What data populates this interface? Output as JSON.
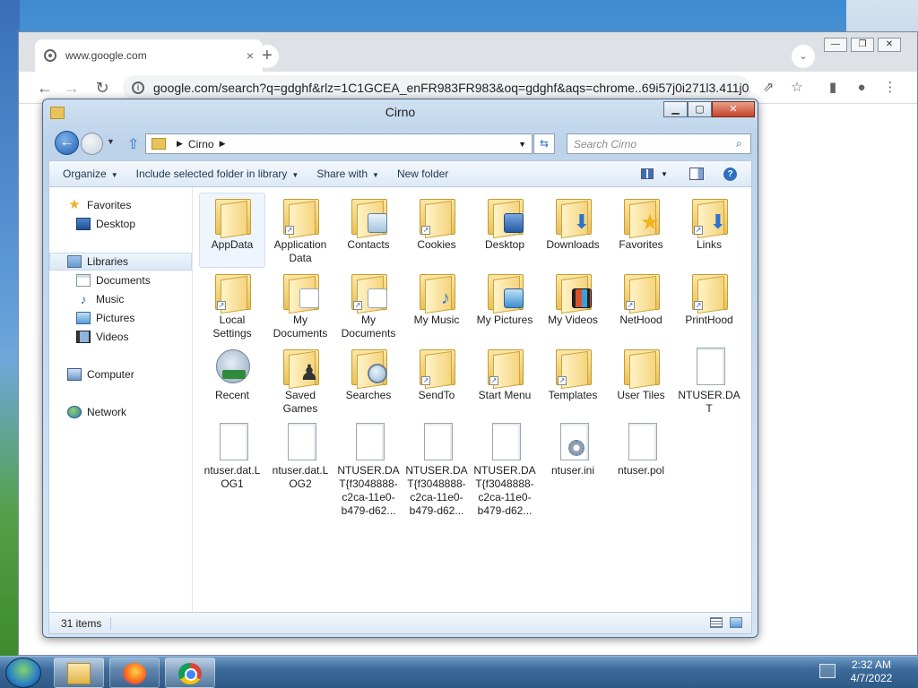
{
  "chrome": {
    "tab_title": "www.google.com",
    "tab_close": "×",
    "new_tab": "+",
    "url": "google.com/search?q=gdghf&rlz=1C1GCEA_enFR983FR983&oq=gdghf&aqs=chrome..69i57j0i271l3.411j0...",
    "nav_back": "←",
    "nav_forward": "→",
    "nav_reload": "↻",
    "win_minimize": "—",
    "win_maximize": "❐",
    "win_close": "✕",
    "tab_search": "⌄",
    "share": "⇗",
    "bookmark": "☆",
    "side_panel": "▮",
    "profile": "●",
    "menu": "⋮",
    "site_info": "i"
  },
  "explorer": {
    "title": "Cirno",
    "caption_min": "▁",
    "caption_max": "▢",
    "caption_close": "✕",
    "back": "←",
    "up": "⇧",
    "breadcrumb": "Cirno",
    "refresh": "⇆",
    "search_placeholder": "Search Cirno",
    "toolbar": {
      "organize": "Organize",
      "include": "Include selected folder in library",
      "share": "Share with",
      "new_folder": "New folder",
      "help": "?"
    },
    "sidebar": {
      "favorites": "Favorites",
      "desktop": "Desktop",
      "libraries": "Libraries",
      "documents": "Documents",
      "music": "Music",
      "pictures": "Pictures",
      "videos": "Videos",
      "computer": "Computer",
      "network": "Network"
    },
    "items": [
      {
        "label": "AppData",
        "type": "folder"
      },
      {
        "label": "Application Data",
        "type": "folder-shortcut"
      },
      {
        "label": "Contacts",
        "type": "folder-contacts"
      },
      {
        "label": "Cookies",
        "type": "folder-shortcut"
      },
      {
        "label": "Desktop",
        "type": "folder-desktop"
      },
      {
        "label": "Downloads",
        "type": "folder-downloads"
      },
      {
        "label": "Favorites",
        "type": "folder-favorites"
      },
      {
        "label": "Links",
        "type": "folder-links"
      },
      {
        "label": "Local Settings",
        "type": "folder-shortcut"
      },
      {
        "label": "My Documents",
        "type": "folder-documents"
      },
      {
        "label": "My Documents",
        "type": "folder-documents-shortcut"
      },
      {
        "label": "My Music",
        "type": "folder-music"
      },
      {
        "label": "My Pictures",
        "type": "folder-pictures"
      },
      {
        "label": "My Videos",
        "type": "folder-videos"
      },
      {
        "label": "NetHood",
        "type": "folder-shortcut"
      },
      {
        "label": "PrintHood",
        "type": "folder-shortcut"
      },
      {
        "label": "Recent",
        "type": "recent"
      },
      {
        "label": "Saved Games",
        "type": "folder-games"
      },
      {
        "label": "Searches",
        "type": "folder-searches"
      },
      {
        "label": "SendTo",
        "type": "folder-shortcut"
      },
      {
        "label": "Start Menu",
        "type": "folder-shortcut"
      },
      {
        "label": "Templates",
        "type": "folder-shortcut"
      },
      {
        "label": "User Tiles",
        "type": "folder"
      },
      {
        "label": "NTUSER.DAT",
        "type": "file"
      },
      {
        "label": "ntuser.dat.LOG1",
        "type": "file"
      },
      {
        "label": "ntuser.dat.LOG2",
        "type": "file"
      },
      {
        "label": "NTUSER.DAT{f3048888-c2ca-11e0-b479-d62...",
        "type": "file"
      },
      {
        "label": "NTUSER.DAT{f3048888-c2ca-11e0-b479-d62...",
        "type": "file"
      },
      {
        "label": "NTUSER.DAT{f3048888-c2ca-11e0-b479-d62...",
        "type": "file"
      },
      {
        "label": "ntuser.ini",
        "type": "file-settings"
      },
      {
        "label": "ntuser.pol",
        "type": "file"
      }
    ],
    "status": "31 items"
  },
  "taskbar": {
    "time": "2:32 AM",
    "date": "4/7/2022"
  },
  "colors": {
    "chrome_tabstrip": "#dee1e6",
    "explorer_frame": "#bcd3ea",
    "selection": "#eef5fd",
    "taskbar": "#3c6a9a"
  }
}
